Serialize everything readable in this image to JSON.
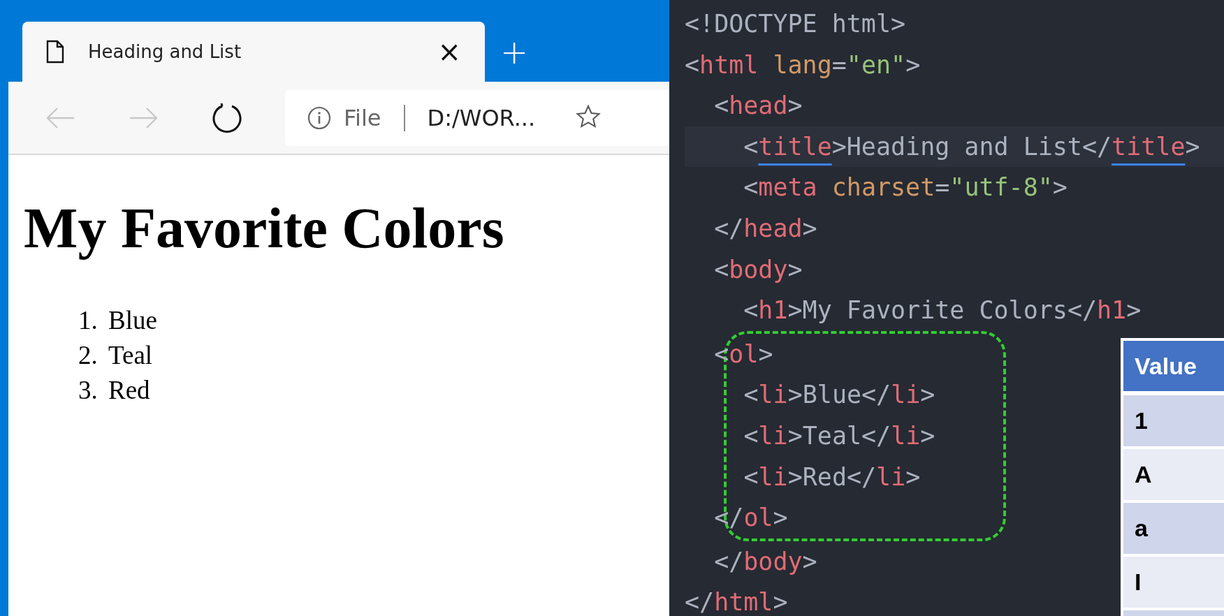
{
  "browser": {
    "tab": {
      "title": "Heading and List",
      "close": "×",
      "selected": true
    },
    "new_tab": "+",
    "toolbar": {
      "back": {
        "disabled": true
      },
      "forward": {
        "disabled": true
      },
      "address": {
        "scheme": "File",
        "url": "D:/WOR..."
      }
    },
    "page": {
      "heading": "My Favorite Colors",
      "list": [
        {
          "number": "1.",
          "text": "Blue"
        },
        {
          "number": "2.",
          "text": "Teal"
        },
        {
          "number": "3.",
          "text": "Red"
        }
      ]
    }
  },
  "editor": {
    "lines": [
      {
        "tokens": [
          {
            "kind": "punct",
            "text": "<!DOCTYPE html>"
          }
        ]
      },
      {
        "tokens": [
          {
            "kind": "punct",
            "text": "<"
          },
          {
            "kind": "tag",
            "text": "html"
          },
          {
            "kind": "attr",
            "text": "lang"
          },
          {
            "kind": "punct",
            "text": "="
          },
          {
            "kind": "string",
            "text": "\"en\""
          },
          {
            "kind": "punct",
            "text": ">"
          }
        ],
        "end_tokens": [
          {
            "kind": "punct",
            "text": "</"
          },
          {
            "kind": "tag",
            "text": "html"
          },
          {
            "kind": "punct",
            "text": ">"
          }
        ],
        "children": [
          {
            "tokens": [
              {
                "kind": "punct",
                "text": "<"
              },
              {
                "kind": "tag",
                "text": "head"
              },
              {
                "kind": "punct",
                "text": ">"
              }
            ],
            "end_tokens": [
              {
                "kind": "punct",
                "text": "</"
              },
              {
                "kind": "tag",
                "text": "head"
              },
              {
                "kind": "punct",
                "text": ">"
              }
            ],
            "children": [
              {
                "highlighted": true,
                "tokens": [
                  {
                    "kind": "punct",
                    "text": "<"
                  },
                  {
                    "kind": "tag",
                    "text": "title",
                    "underlined": true
                  },
                  {
                    "kind": "punct",
                    "text": ">"
                  },
                  {
                    "kind": "text",
                    "text": "Heading and List"
                  },
                  {
                    "kind": "punct",
                    "text": "</"
                  },
                  {
                    "kind": "tag",
                    "text": "title",
                    "underlined": true
                  },
                  {
                    "kind": "punct",
                    "text": ">"
                  }
                ]
              },
              {
                "tokens": [
                  {
                    "kind": "punct",
                    "text": "<"
                  },
                  {
                    "kind": "tag",
                    "text": "meta"
                  },
                  {
                    "kind": "attr",
                    "text": "charset"
                  },
                  {
                    "kind": "punct",
                    "text": "="
                  },
                  {
                    "kind": "string",
                    "text": "\"utf-8\""
                  },
                  {
                    "kind": "punct",
                    "text": ">"
                  }
                ]
              }
            ]
          },
          {
            "tokens": [
              {
                "kind": "punct",
                "text": "<"
              },
              {
                "kind": "tag",
                "text": "body"
              },
              {
                "kind": "punct",
                "text": ">"
              }
            ],
            "end_tokens": [
              {
                "kind": "punct",
                "text": "</"
              },
              {
                "kind": "tag",
                "text": "body"
              },
              {
                "kind": "punct",
                "text": ">"
              }
            ],
            "children": [
              {
                "tokens": [
                  {
                    "kind": "punct",
                    "text": "<"
                  },
                  {
                    "kind": "tag",
                    "text": "h1"
                  },
                  {
                    "kind": "punct",
                    "text": ">"
                  },
                  {
                    "kind": "text",
                    "text": "My Favorite Colors"
                  },
                  {
                    "kind": "punct",
                    "text": "</"
                  },
                  {
                    "kind": "tag",
                    "text": "h1"
                  },
                  {
                    "kind": "punct",
                    "text": ">"
                  }
                ]
              },
              {
                "outlined": true,
                "tokens": [
                  {
                    "kind": "punct",
                    "text": "<"
                  },
                  {
                    "kind": "tag",
                    "text": "ol"
                  },
                  {
                    "kind": "punct",
                    "text": ">"
                  }
                ],
                "end_tokens": [
                  {
                    "kind": "punct",
                    "text": "</"
                  },
                  {
                    "kind": "tag",
                    "text": "ol"
                  },
                  {
                    "kind": "punct",
                    "text": ">"
                  }
                ],
                "children": [
                  {
                    "tokens": [
                      {
                        "kind": "punct",
                        "text": "<"
                      },
                      {
                        "kind": "tag",
                        "text": "li"
                      },
                      {
                        "kind": "punct",
                        "text": ">"
                      },
                      {
                        "kind": "text",
                        "text": "Blue"
                      },
                      {
                        "kind": "punct",
                        "text": "</"
                      },
                      {
                        "kind": "tag",
                        "text": "li"
                      },
                      {
                        "kind": "punct",
                        "text": ">"
                      }
                    ]
                  },
                  {
                    "tokens": [
                      {
                        "kind": "punct",
                        "text": "<"
                      },
                      {
                        "kind": "tag",
                        "text": "li"
                      },
                      {
                        "kind": "punct",
                        "text": ">"
                      },
                      {
                        "kind": "text",
                        "text": "Teal"
                      },
                      {
                        "kind": "punct",
                        "text": "</"
                      },
                      {
                        "kind": "tag",
                        "text": "li"
                      },
                      {
                        "kind": "punct",
                        "text": ">"
                      }
                    ]
                  },
                  {
                    "tokens": [
                      {
                        "kind": "punct",
                        "text": "<"
                      },
                      {
                        "kind": "tag",
                        "text": "li"
                      },
                      {
                        "kind": "punct",
                        "text": ">"
                      },
                      {
                        "kind": "text",
                        "text": "Red"
                      },
                      {
                        "kind": "punct",
                        "text": "</"
                      },
                      {
                        "kind": "tag",
                        "text": "li"
                      },
                      {
                        "kind": "punct",
                        "text": ">"
                      }
                    ]
                  }
                ]
              }
            ]
          }
        ]
      }
    ]
  },
  "table": {
    "columns": [
      "Value"
    ],
    "rows": [
      [
        "1"
      ],
      [
        "A"
      ],
      [
        "a"
      ],
      [
        "I"
      ]
    ]
  }
}
